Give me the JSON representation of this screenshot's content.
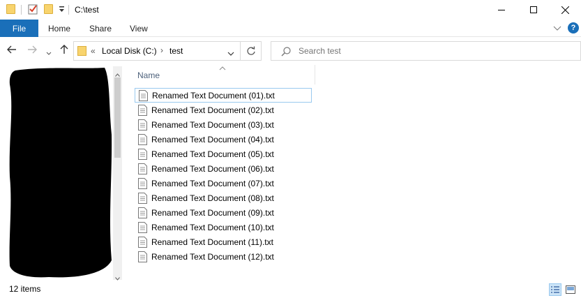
{
  "titlebar": {
    "title": "C:\\test",
    "minimize_icon": "minimize-icon",
    "maximize_icon": "maximize-icon",
    "close_icon": "close-icon"
  },
  "ribbon": {
    "tabs": [
      "File",
      "Home",
      "Share",
      "View"
    ],
    "active_color": "#1a6fb9",
    "help_label": "?"
  },
  "address": {
    "overflow": "«",
    "crumbs": [
      "Local Disk (C:)",
      "test"
    ],
    "separator": "›"
  },
  "search": {
    "placeholder": "Search test"
  },
  "file_list": {
    "column_name": "Name",
    "files": [
      "Renamed Text Document (01).txt",
      "Renamed Text Document (02).txt",
      "Renamed Text Document (03).txt",
      "Renamed Text Document (04).txt",
      "Renamed Text Document (05).txt",
      "Renamed Text Document (06).txt",
      "Renamed Text Document (07).txt",
      "Renamed Text Document (08).txt",
      "Renamed Text Document (09).txt",
      "Renamed Text Document (10).txt",
      "Renamed Text Document (11).txt",
      "Renamed Text Document (12).txt"
    ]
  },
  "statusbar": {
    "item_count": "12 items"
  }
}
